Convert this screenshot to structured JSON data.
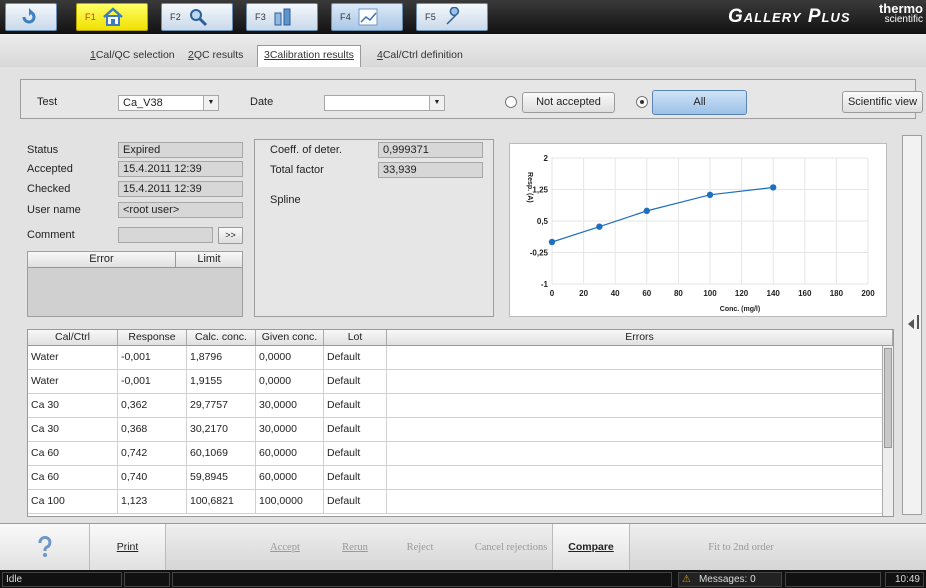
{
  "topbar": {
    "keys": [
      {
        "label": "",
        "icon": "refresh-icon"
      },
      {
        "label": "F1",
        "icon": "home-icon"
      },
      {
        "label": "F2",
        "icon": "search-icon"
      },
      {
        "label": "F3",
        "icon": "vials-icon"
      },
      {
        "label": "F4",
        "icon": "chart-icon"
      },
      {
        "label": "F5",
        "icon": "wrench-icon"
      }
    ],
    "brand": "Gallery Plus",
    "logo_line1": "thermo",
    "logo_line2": "scientific"
  },
  "tabs": [
    {
      "num": "1",
      "label": "Cal/QC selection"
    },
    {
      "num": "2",
      "label": "QC results"
    },
    {
      "num": "3",
      "label": "Calibration results"
    },
    {
      "num": "4",
      "label": "Cal/Ctrl definition"
    }
  ],
  "filter": {
    "test_label": "Test",
    "test_value": "Ca_V38",
    "date_label": "Date",
    "date_value": "",
    "not_accepted": "Not accepted",
    "all": "All",
    "scientific_view": "Scientific view"
  },
  "info": {
    "status_label": "Status",
    "status_value": "Expired",
    "accepted_label": "Accepted",
    "accepted_value": "15.4.2011 12:39",
    "checked_label": "Checked",
    "checked_value": "15.4.2011 12:39",
    "user_label": "User name",
    "user_value": "<root user>",
    "comment_label": "Comment",
    "comment_btn": ">>",
    "error_col": "Error",
    "limit_col": "Limit"
  },
  "coeff": {
    "coeff_label": "Coeff. of deter.",
    "coeff_value": "0,999371",
    "total_label": "Total factor",
    "total_value": "33,939",
    "spline_label": "Spline"
  },
  "chart_data": {
    "type": "line",
    "xlabel": "Conc. (mg/l)",
    "ylabel": "Resp. (A)",
    "xlim": [
      0,
      200
    ],
    "ylim": [
      -1,
      2
    ],
    "xticks": [
      "0",
      "20",
      "40",
      "60",
      "80",
      "100",
      "120",
      "140",
      "160",
      "180",
      "200"
    ],
    "yticks": [
      "2",
      "1,25",
      "0,5",
      "-0,25",
      "-1"
    ],
    "points": [
      {
        "x": 0,
        "y": 0.0
      },
      {
        "x": 30,
        "y": 0.365
      },
      {
        "x": 60,
        "y": 0.741
      },
      {
        "x": 100,
        "y": 1.123
      },
      {
        "x": 140,
        "y": 1.3
      }
    ],
    "grid": true,
    "color": "#1f6fbf"
  },
  "table": {
    "headers": [
      "Cal/Ctrl",
      "Response",
      "Calc. conc.",
      "Given conc.",
      "Lot",
      "Errors"
    ],
    "rows": [
      [
        "Water",
        "-0,001",
        "1,8796",
        "0,0000",
        "Default",
        ""
      ],
      [
        "Water",
        "-0,001",
        "1,9155",
        "0,0000",
        "Default",
        ""
      ],
      [
        "Ca 30",
        "0,362",
        "29,7757",
        "30,0000",
        "Default",
        ""
      ],
      [
        "Ca 30",
        "0,368",
        "30,2170",
        "30,0000",
        "Default",
        ""
      ],
      [
        "Ca 60",
        "0,742",
        "60,1069",
        "60,0000",
        "Default",
        ""
      ],
      [
        "Ca 60",
        "0,740",
        "59,8945",
        "60,0000",
        "Default",
        ""
      ],
      [
        "Ca 100",
        "1,123",
        "100,6821",
        "100,0000",
        "Default",
        ""
      ]
    ]
  },
  "toolbar": {
    "help_icon": "question-icon",
    "print": "Print",
    "accept": "Accept",
    "rerun": "Rerun",
    "reject": "Reject",
    "cancel_rejections": "Cancel rejections",
    "compare": "Compare",
    "fit": "Fit to 2nd order"
  },
  "statusbar": {
    "state": "Idle",
    "messages": "Messages: 0",
    "time": "10:49"
  }
}
